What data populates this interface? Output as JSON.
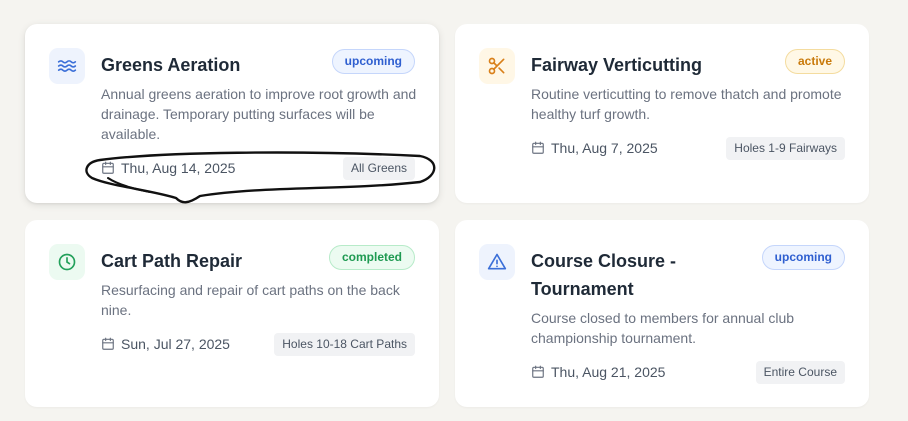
{
  "cards": [
    {
      "title": "Greens Aeration",
      "status": "upcoming",
      "description": "Annual greens aeration to improve root growth and drainage. Temporary putting surfaces will be available.",
      "date": "Thu, Aug 14, 2025",
      "location": "All Greens",
      "icon": "waves-icon",
      "icon_color": "#3b6fd8",
      "icon_bg": "#eef3fd"
    },
    {
      "title": "Fairway Verticutting",
      "status": "active",
      "description": "Routine verticutting to remove thatch and promote healthy turf growth.",
      "date": "Thu, Aug 7, 2025",
      "location": "Holes 1-9 Fairways",
      "icon": "scissors-icon",
      "icon_color": "#d9801a",
      "icon_bg": "#fff7e6"
    },
    {
      "title": "Cart Path Repair",
      "status": "completed",
      "description": "Resurfacing and repair of cart paths on the back nine.",
      "date": "Sun, Jul 27, 2025",
      "location": "Holes 10-18 Cart Paths",
      "icon": "clock-icon",
      "icon_color": "#22a05a",
      "icon_bg": "#ecfaf1"
    },
    {
      "title": "Course Closure - Tournament",
      "status": "upcoming",
      "description": "Course closed to members for annual club championship tournament.",
      "date": "Thu, Aug 21, 2025",
      "location": "Entire Course",
      "icon": "alert-triangle-icon",
      "icon_color": "#3b6fd8",
      "icon_bg": "#eef3fd"
    }
  ]
}
